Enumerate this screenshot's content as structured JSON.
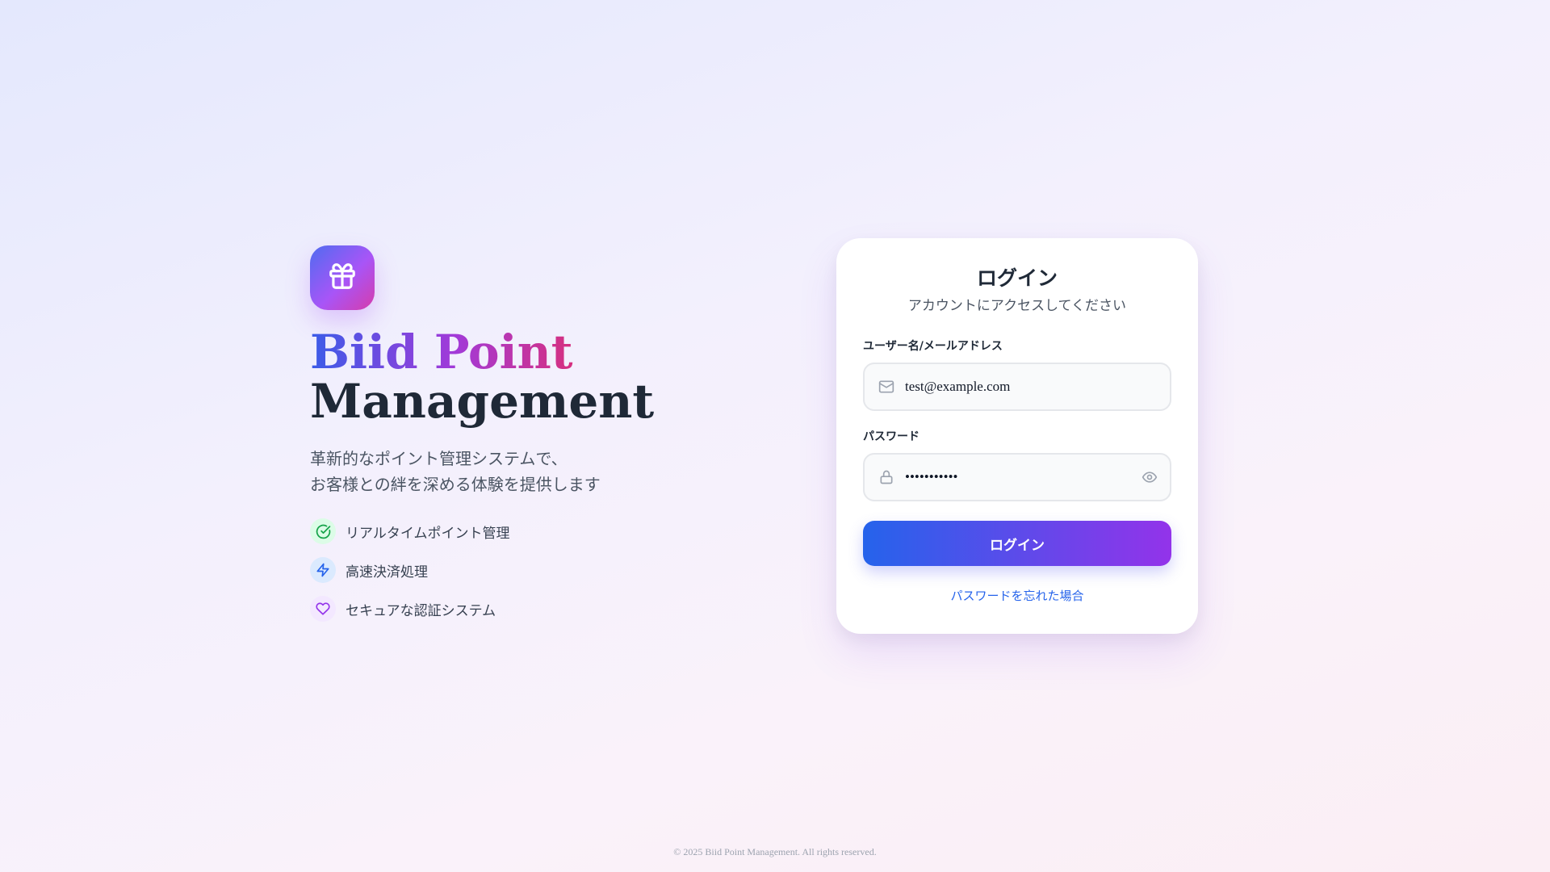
{
  "hero": {
    "brand_line1": "Biid Point",
    "brand_line2": "Management",
    "tagline_line1": "革新的なポイント管理システムで、",
    "tagline_line2": "お客様との絆を深める体験を提供します",
    "logo_icon": "gift-icon",
    "features": [
      {
        "label": "リアルタイムポイント管理",
        "icon": "check-circle-icon",
        "color": "#16a34a"
      },
      {
        "label": "高速決済処理",
        "icon": "lightning-icon",
        "color": "#2563eb"
      },
      {
        "label": "セキュアな認証システム",
        "icon": "heart-icon",
        "color": "#9333ea"
      }
    ]
  },
  "login": {
    "title": "ログイン",
    "subtitle": "アカウントにアクセスしてください",
    "username_label": "ユーザー名/メールアドレス",
    "username_value": "test@example.com",
    "password_label": "パスワード",
    "password_value": "password123",
    "submit_label": "ログイン",
    "forgot_label": "パスワードを忘れた場合"
  },
  "footer": {
    "copyright": "© 2025 Biid Point Management. All rights reserved."
  },
  "colors": {
    "accent_blue": "#2563eb",
    "accent_purple": "#9333ea",
    "accent_pink": "#d6307f"
  }
}
